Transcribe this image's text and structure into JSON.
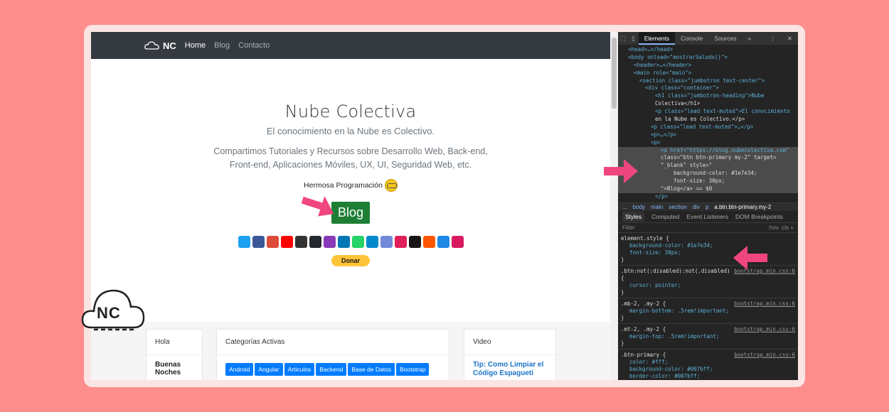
{
  "nav": {
    "logo": "NC",
    "links": [
      "Home",
      "Blog",
      "Contacto"
    ]
  },
  "hero": {
    "title": "Nube Colectiva",
    "lead": "El conocimiento en la Nube es Colectivo.",
    "desc_line1": "Compartimos Tutoriales y Recursos sobre Desarrollo Web, Back-end,",
    "desc_line2": "Front-end, Aplicaciones Móviles, UX, UI, Seguridad Web, etc.",
    "hermosa": "Hermosa Programación",
    "blog_button": "Blog",
    "donate_button": "Donar"
  },
  "social_icons": [
    {
      "name": "twitter",
      "color": "#1da1f2"
    },
    {
      "name": "facebook",
      "color": "#3b5998"
    },
    {
      "name": "google-plus",
      "color": "#dd4b39"
    },
    {
      "name": "youtube",
      "color": "#ff0000"
    },
    {
      "name": "youtube-dark",
      "color": "#333333"
    },
    {
      "name": "github",
      "color": "#24292e"
    },
    {
      "name": "instagram",
      "color": "#8a3ab9"
    },
    {
      "name": "linkedin",
      "color": "#0077b5"
    },
    {
      "name": "whatsapp",
      "color": "#25d366"
    },
    {
      "name": "telegram",
      "color": "#0088cc"
    },
    {
      "name": "discord",
      "color": "#7289da"
    },
    {
      "name": "slack",
      "color": "#e01e5a"
    },
    {
      "name": "spotify",
      "color": "#191414"
    },
    {
      "name": "soundcloud",
      "color": "#ff5500"
    },
    {
      "name": "exchange",
      "color": "#1e88e5"
    },
    {
      "name": "hands",
      "color": "#d81b60"
    }
  ],
  "cards": {
    "hola": {
      "header": "Hola",
      "body": "Buenas Noches"
    },
    "categorias": {
      "header": "Categorías Activas",
      "tags": [
        "Android",
        "Angular",
        "Articulos",
        "Backend",
        "Base de Datos",
        "Bootstrap"
      ]
    },
    "video": {
      "header": "Video",
      "link": "Tip: Como Limpiar el Código Espagueti"
    }
  },
  "devtools": {
    "tabs": [
      "Elements",
      "Console",
      "Sources",
      "»"
    ],
    "tree": [
      "<head>…</head>",
      "<body onload=\"mostrarSaludo()\">",
      "<header>…</header>",
      "<main role=\"main\">",
      "<section class=\"jumbotron text-center\">",
      "<div class=\"container\">",
      "<h1 class=\"jumbotron-heading\">Nube",
      "Colectiva</h1>",
      "<p class=\"lead text-muted\">El conocimiento",
      "en la Nube es Colectivo.</p>",
      "<p class=\"lead text-muted\">…</p>",
      "<p>…</p>",
      "<p>",
      "<a href=\"https://blog.nubecolectiva.com\"",
      "class=\"btn btn-primary my-2\" target=",
      "\"_blank\" style=\"",
      "background-color: #1e7e34;",
      "font-size: 30px;",
      "\">Blog</a> == $0",
      "</p>"
    ],
    "breadcrumbs": [
      "...",
      "body",
      "main",
      "section",
      "div",
      "p",
      "a.btn.btn-primary.my-2"
    ],
    "subtabs": [
      "Styles",
      "Computed",
      "Event Listeners",
      "DOM Breakpoints"
    ],
    "filter": {
      "placeholder": "Filter",
      "hov": ":hov",
      "cls": ".cls"
    },
    "rules": [
      {
        "selector": "element.style {",
        "source": "",
        "props": [
          "background-color: #1e7e34;",
          "font-size: 30px;"
        ]
      },
      {
        "selector": ".btn:not(:disabled):not(.disabled) {",
        "source": "bootstrap.min.css:6",
        "props": [
          "cursor: pointer;"
        ]
      },
      {
        "selector": ".mb-2, .my-2 {",
        "source": "bootstrap.min.css:6",
        "props": [
          "margin-bottom: .5rem!important;"
        ]
      },
      {
        "selector": ".mt-2, .my-2 {",
        "source": "bootstrap.min.css:6",
        "props": [
          "margin-top: .5rem!important;"
        ]
      },
      {
        "selector": ".btn-primary {",
        "source": "bootstrap.min.css:6",
        "props": [
          "color: #fff;",
          "background-color: #007bff;",
          "border-color: #007bff;"
        ]
      }
    ]
  },
  "watermark": "NC",
  "colors": {
    "background": "#fd8e8c",
    "blog_button": "#1e7e34",
    "arrow": "#f0467f"
  }
}
